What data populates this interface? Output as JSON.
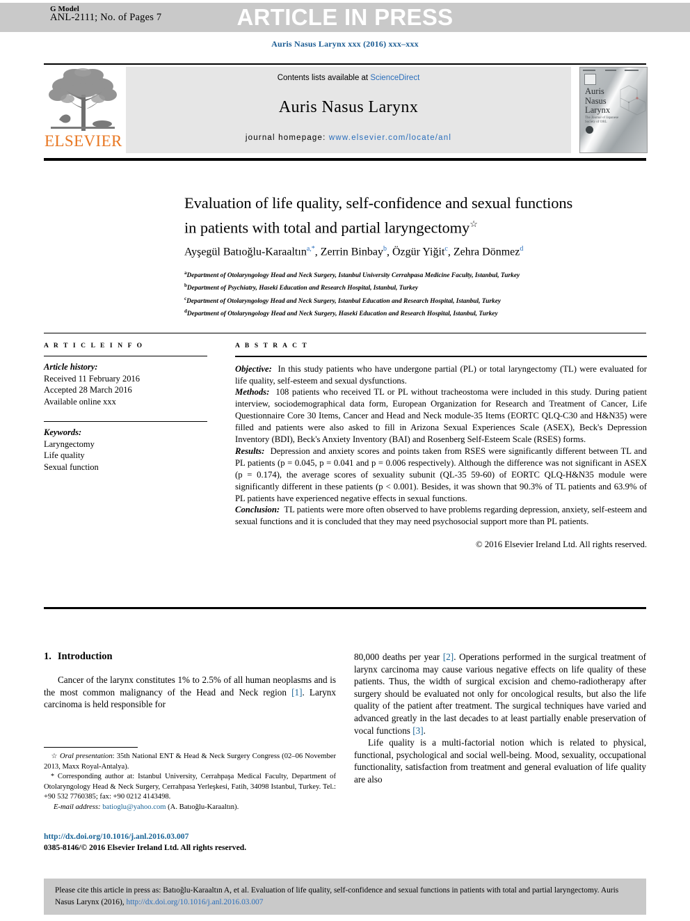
{
  "header": {
    "g_model": "G Model",
    "model_id": "ANL-2111; No. of Pages 7",
    "banner": "ARTICLE IN PRESS",
    "journal_ref": "Auris Nasus Larynx xxx (2016) xxx–xxx"
  },
  "masthead": {
    "contents_prefix": "Contents lists available at ",
    "contents_link": "ScienceDirect",
    "journal_title": "Auris Nasus Larynx",
    "homepage_label": "journal homepage: ",
    "homepage_url": "www.elsevier.com/locate/anl",
    "publisher": "ELSEVIER",
    "cover_title_l1": "Auris",
    "cover_title_l2": "Nasus",
    "cover_title_l3": "Larynx",
    "cover_subtitle": "The Journal of Japanese Society of ORL"
  },
  "article": {
    "title_line1": "Evaluation of life quality, self-confidence and sexual functions",
    "title_line2": "in patients with total and partial laryngectomy",
    "title_footnote_mark": "☆",
    "authors_text": "Ayşegül Batıoğlu-Karaaltın a,*, Zerrin Binbay b, Özgür Yiğit c, Zehra Dönmez d",
    "affiliations": [
      {
        "mark": "a",
        "text": "Department of Otolaryngology Head and Neck Surgery, Istanbul University Cerrahpasa Medicine Faculty, Istanbul, Turkey"
      },
      {
        "mark": "b",
        "text": "Department of Psychiatry, Haseki Education and Research Hospital, Istanbul, Turkey"
      },
      {
        "mark": "c",
        "text": "Department of Otolaryngology Head and Neck Surgery, Istanbul Education and Research Hospital, Istanbul, Turkey"
      },
      {
        "mark": "d",
        "text": "Department of Otolaryngology Head and Neck Surgery, Haseki Education and Research Hospital, Istanbul, Turkey"
      }
    ]
  },
  "info": {
    "heading": "A R T I C L E   I N F O",
    "history_label": "Article history:",
    "history": [
      "Received 11 February 2016",
      "Accepted 28 March 2016",
      "Available online xxx"
    ],
    "keywords_label": "Keywords:",
    "keywords": [
      "Laryngectomy",
      "Life quality",
      "Sexual function"
    ]
  },
  "abstract": {
    "heading": "A B S T R A C T",
    "objective_label": "Objective:",
    "objective_text": "In this study patients who have undergone partial (PL) or total laryngectomy (TL) were evaluated for life quality, self-esteem and sexual dysfunctions.",
    "methods_label": "Methods:",
    "methods_text": "108 patients who received TL or PL without tracheostoma were included in this study. During patient interview, sociodemographical data form, European Organization for Research and Treatment of Cancer, Life Questionnaire Core 30 Items, Cancer and Head and Neck module-35 Items (EORTC QLQ-C30 and H&N35) were filled and patients were also asked to fill in Arizona Sexual Experiences Scale (ASEX), Beck's Depression Inventory (BDI), Beck's Anxiety Inventory (BAI) and Rosenberg Self-Esteem Scale (RSES) forms.",
    "results_label": "Results:",
    "results_text": "Depression and anxiety scores and points taken from RSES were significantly different between TL and PL patients (p = 0.045, p = 0.041    and p = 0.006 respectively). Although the difference was not significant in ASEX (p = 0.174), the average scores of sexuality subunit (QL-35 59-60) of EORTC QLQ-H&N35 module were significantly different in these patients (p < 0.001). Besides, it was shown that 90.3% of TL patients and 63.9% of PL patients have experienced negative effects in sexual functions.",
    "conclusion_label": "Conclusion:",
    "conclusion_text": "TL patients were more often observed to have problems regarding depression, anxiety, self-esteem and sexual functions and it is concluded that they may need psychosocial support more than PL patients.",
    "copyright": "© 2016 Elsevier Ireland Ltd. All rights reserved."
  },
  "body": {
    "section_number": "1.",
    "section_title": "Introduction",
    "para1_a": "Cancer of the larynx constitutes 1% to 2.5% of all human neoplasms and is the most common malignancy of the Head and Neck region ",
    "para1_ref": "[1]",
    "para1_b": ". Larynx carcinoma is held responsible for",
    "para2_a": "80,000 deaths per year ",
    "para2_ref": "[2]",
    "para2_b": ". Operations performed in the surgical treatment of larynx carcinoma may cause various negative effects on life quality of these patients. Thus, the width of surgical excision and chemo-radiotherapy after surgery should be evaluated not only for oncological results, but also the life quality of the patient after treatment. The surgical techniques have varied and advanced greatly in the last decades to at least partially enable preservation of vocal functions ",
    "para2_ref2": "[3]",
    "para2_c": ".",
    "para3": "Life quality is a multi-factorial notion which is related to physical, functional, psychological and social well-being. Mood, sexuality, occupational functionality, satisfaction from treatment and general evaluation of life quality are also"
  },
  "footnotes": {
    "oral_mark": "☆",
    "oral_label": "Oral presentation",
    "oral_text": ": 35th National ENT & Head & Neck Surgery Congress (02–06 November 2013, Maxx Royal-Antalya).",
    "corr_mark": "*",
    "corr_text": "Corresponding author at: Istanbul University, Cerrahpaşa Medical Faculty, Department of Otolaryngology Head & Neck Surgery, Cerrahpasa Yerleşkesi, Fatih, 34098 Istanbul, Turkey. Tel.: +90 532 7760385; fax: +90 0212 4143498.",
    "email_label": "E-mail address:",
    "email": "batioglu@yahoo.com",
    "email_owner": "(A. Batıoğlu-Karaaltın).",
    "doi_url": "http://dx.doi.org/10.1016/j.anl.2016.03.007",
    "issn_line": "0385-8146/© 2016 Elsevier Ireland Ltd. All rights reserved."
  },
  "citation": {
    "text_a": "Please cite this article in press as: Batıoğlu-Karaaltın A, et al. Evaluation of life quality, self-confidence and sexual functions in patients with total and partial laryngectomy. Auris Nasus Larynx (2016), ",
    "doi": "http://dx.doi.org/10.1016/j.anl.2016.03.007"
  },
  "colors": {
    "link_blue": "#2a6ebb",
    "ref_blue": "#1a6496",
    "elsevier_orange": "#e87722",
    "band_gray": "#c9c9c9",
    "mast_gray": "#e6e6e6"
  }
}
